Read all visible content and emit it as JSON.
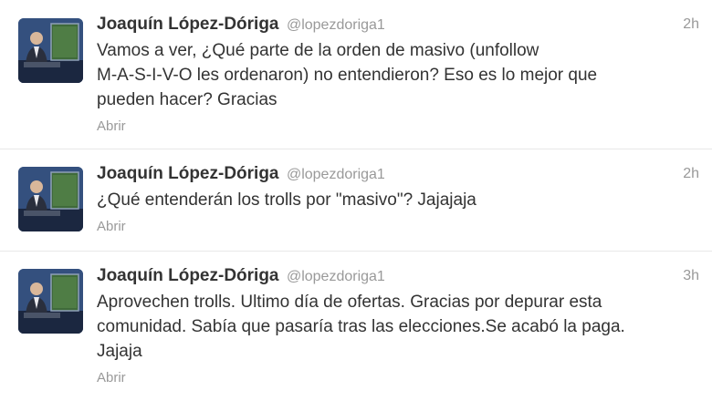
{
  "tweets": [
    {
      "fullname": "Joaquín López-Dóriga",
      "username": "@lopezdoriga1",
      "time": "2h",
      "lines": [
        "Vamos a ver, ¿Qué parte de la orden de masivo (unfollow",
        "M-A-S-I-V-O les ordenaron) no entendieron? Eso es lo mejor que",
        "pueden hacer? Gracias"
      ],
      "action": "Abrir"
    },
    {
      "fullname": "Joaquín López-Dóriga",
      "username": "@lopezdoriga1",
      "time": "2h",
      "lines": [
        "¿Qué entenderán los trolls por \"masivo\"? Jajajaja"
      ],
      "action": "Abrir"
    },
    {
      "fullname": "Joaquín López-Dóriga",
      "username": "@lopezdoriga1",
      "time": "3h",
      "lines": [
        "Aprovechen trolls. Ultimo día de ofertas. Gracias por depurar esta",
        "comunidad. Sabía que pasaría tras las elecciones.Se acabó la paga.",
        "Jajaja"
      ],
      "action": "Abrir"
    }
  ]
}
